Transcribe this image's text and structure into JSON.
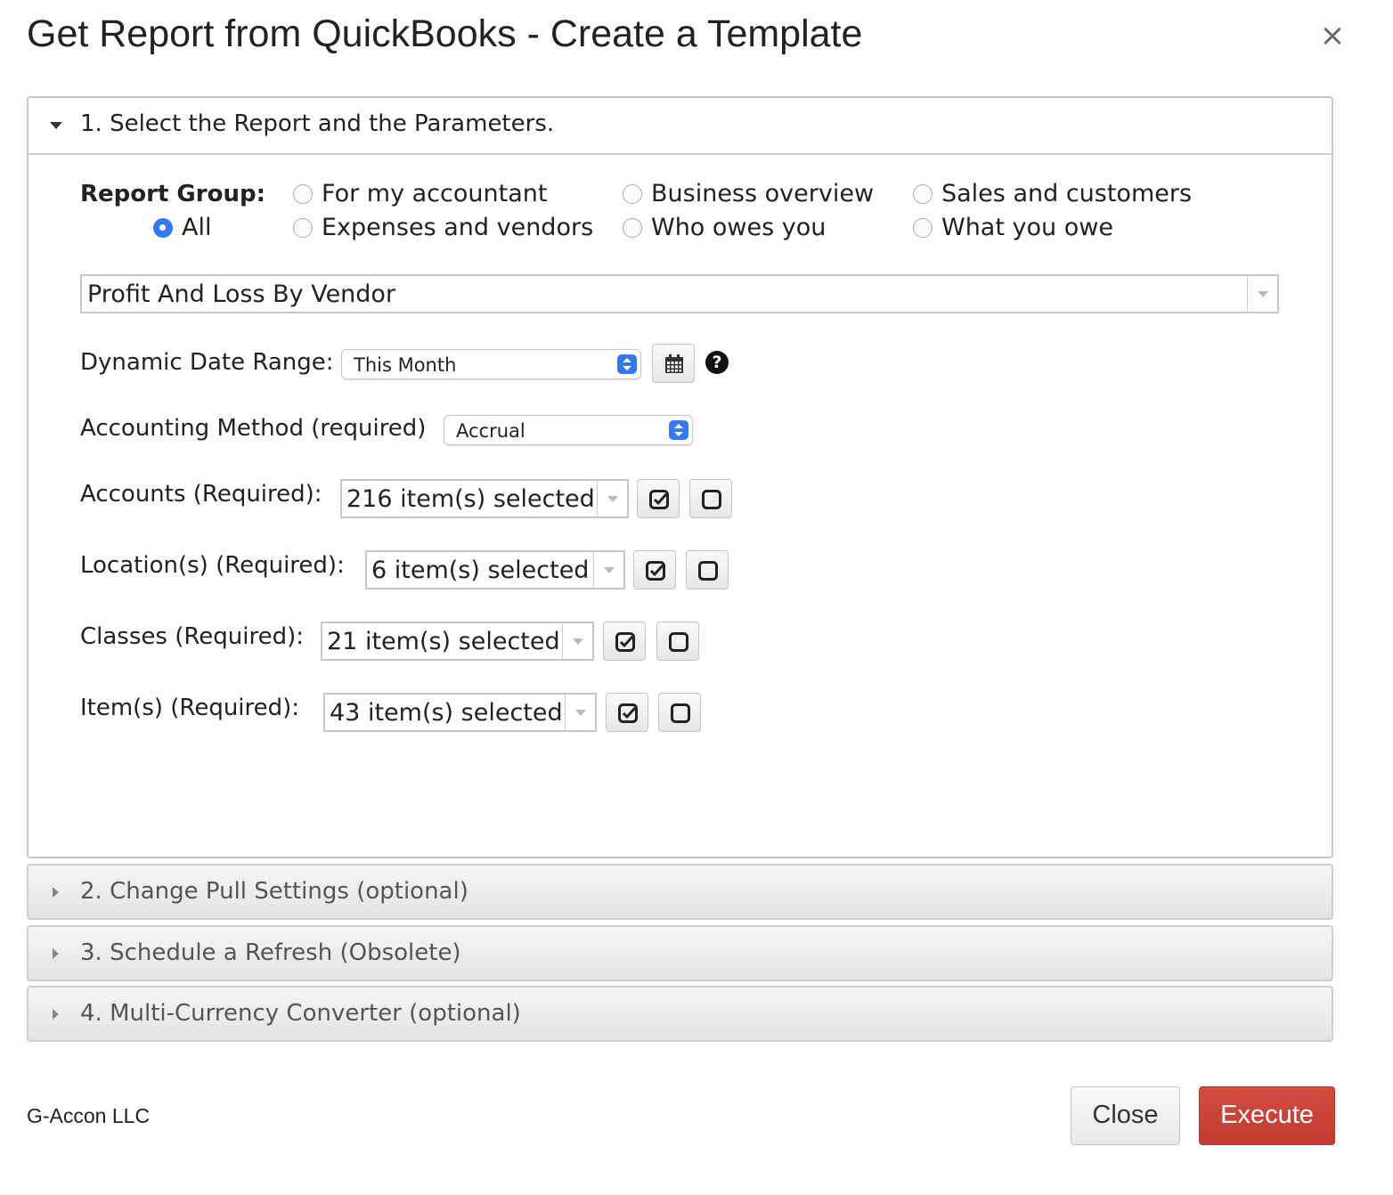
{
  "dialog": {
    "title": "Get Report from QuickBooks - Create a Template",
    "close_symbol": "×"
  },
  "section1": {
    "header": "1. Select the Report and the Parameters.",
    "report_group": {
      "label": "Report Group:",
      "options": [
        {
          "label": "All",
          "checked": true
        },
        {
          "label": "For my accountant",
          "checked": false
        },
        {
          "label": "Expenses and vendors",
          "checked": false
        },
        {
          "label": "Business overview",
          "checked": false
        },
        {
          "label": "Who owes you",
          "checked": false
        },
        {
          "label": "Sales and customers",
          "checked": false
        },
        {
          "label": "What you owe",
          "checked": false
        }
      ]
    },
    "report_select": {
      "value": "Profit And Loss By Vendor"
    },
    "date_range": {
      "label": "Dynamic Date Range:",
      "value": "This Month",
      "help_symbol": "?"
    },
    "accounting_method": {
      "label": "Accounting Method (required)",
      "value": "Accrual"
    },
    "accounts": {
      "label": "Accounts (Required):",
      "value": "216 item(s) selected"
    },
    "locations": {
      "label": "Location(s) (Required):",
      "value": "6 item(s) selected"
    },
    "classes": {
      "label": "Classes (Required):",
      "value": "21 item(s) selected"
    },
    "items": {
      "label": "Item(s) (Required):",
      "value": "43 item(s) selected"
    }
  },
  "sections": [
    {
      "label": "2. Change Pull Settings (optional)"
    },
    {
      "label": "3. Schedule a Refresh (Obsolete)"
    },
    {
      "label": "4. Multi-Currency Converter (optional)"
    }
  ],
  "footer": {
    "brand": "G-Accon LLC",
    "close_label": "Close",
    "execute_label": "Execute"
  },
  "colors": {
    "accent_blue": "#3478f6",
    "execute_red": "#c9433a"
  },
  "icons": {
    "calendar": "calendar-icon",
    "help": "help-icon",
    "select_all": "checkbox-checked-icon",
    "deselect_all": "checkbox-empty-icon"
  }
}
